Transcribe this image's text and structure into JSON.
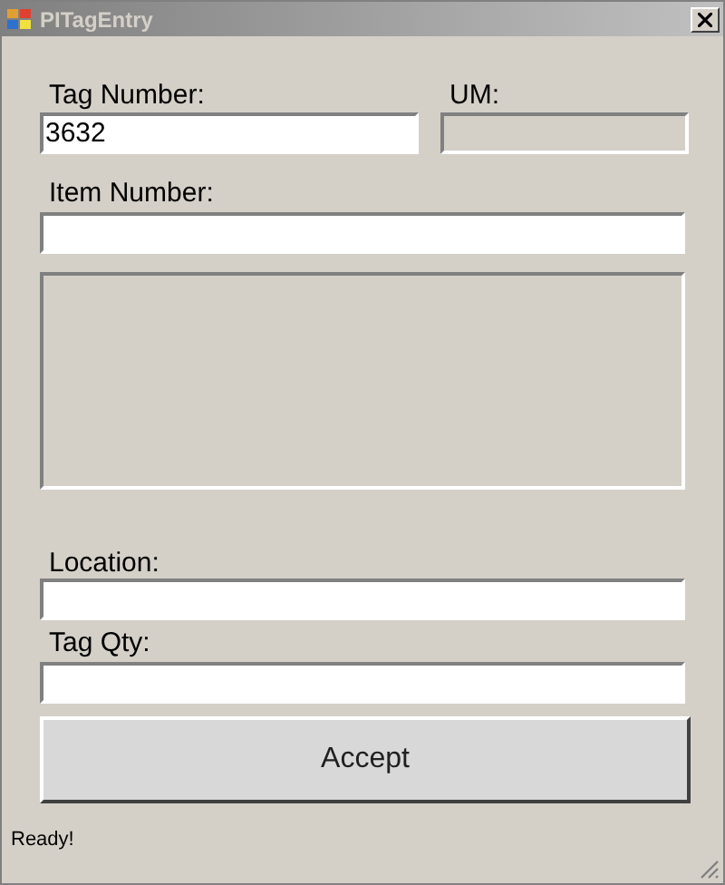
{
  "window": {
    "title": "PITagEntry",
    "active": false
  },
  "tag_number": {
    "label": "Tag Number:",
    "value": "3632",
    "disabled": false
  },
  "um": {
    "label": "UM:",
    "disabled": true
  },
  "item_number": {
    "label": "Item Number:",
    "disabled": false
  },
  "list_box": {
    "disabled": true
  },
  "location": {
    "label": "Location:",
    "disabled": false
  },
  "tag_qty": {
    "label": "Tag Qty:",
    "disabled": false
  },
  "accept_button": {
    "label": "Accept"
  },
  "status_bar": {
    "text": "Ready!"
  }
}
